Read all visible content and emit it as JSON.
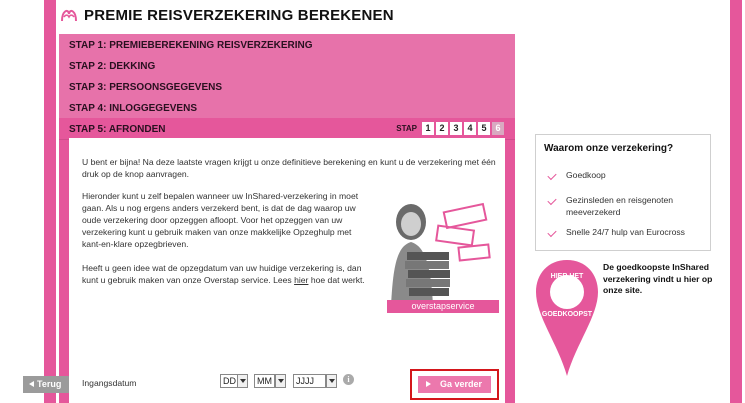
{
  "page": {
    "title": "PREMIE REISVERZEKERING BEREKENEN"
  },
  "steps": [
    {
      "label": "STAP 1: PREMIEBEREKENING REISVERZEKERING"
    },
    {
      "label": "STAP 2: DEKKING"
    },
    {
      "label": "STAP 3: PERSOONSGEGEVENS"
    },
    {
      "label": "STAP 4: INLOGGEGEVENS"
    },
    {
      "label": "STAP 5: AFRONDEN"
    }
  ],
  "stap_nav": {
    "label": "STAP",
    "numbers": [
      "1",
      "2",
      "3",
      "4",
      "5",
      "6"
    ],
    "current": 6
  },
  "content": {
    "intro": "U bent er bijna! Na deze laatste vragen krijgt u onze definitieve berekening en kunt u de verzekering met één druk op de knop aanvragen.",
    "para2": "Hieronder kunt u zelf bepalen wanneer uw InShared-verzekering in moet gaan. Als u nog ergens anders verzekerd bent, is dat de dag waarop uw oude verzekering door opzeggen afloopt. Voor het opzeggen van uw verzekering kunt u gebruik maken van onze makkelijke Opzeghulp met kant-en-klare opzegbrieven.",
    "para3_before": "Heeft u geen idee wat de opzegdatum van uw huidige verzekering is, dan kunt u gebruik maken van onze Overstap service. Lees ",
    "para3_link": "hier",
    "para3_after": " hoe dat werkt.",
    "badge": "overstapservice"
  },
  "form": {
    "date_label": "Ingangsdatum",
    "day": "DD",
    "month": "MM",
    "year": "JJJJ",
    "info": "i"
  },
  "buttons": {
    "back": "Terug",
    "next": "Ga verder"
  },
  "sidebar": {
    "why_title": "Waarom onze verzekering?",
    "items": [
      "Goedkoop",
      "Gezinsleden en reisgenoten meeverzekerd",
      "Snelle 24/7 hulp van Eurocross"
    ],
    "badge_line1": "HIER HET",
    "badge_line2": "GOEDKOOPST",
    "cheap_text": "De goedkoopste InShared verzekering vindt u hier op onze site."
  },
  "colors": {
    "brand": "#e5579b",
    "highlight": "#d4161b"
  }
}
